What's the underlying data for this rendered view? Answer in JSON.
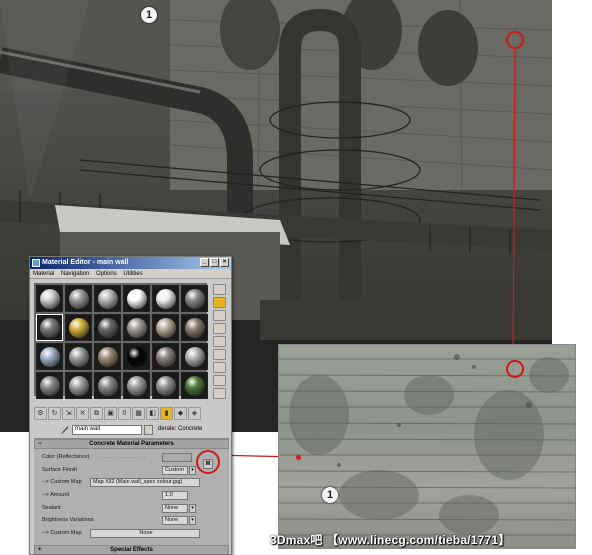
{
  "scene": {
    "marker": "1"
  },
  "texture": {
    "marker": "1"
  },
  "watermark": "3Dmax吧 【www.linecg.com/tieba/1771】",
  "editor": {
    "title": "Material Editor - main wall",
    "window_buttons": [
      "_",
      "□",
      "×"
    ],
    "menu": [
      "Material",
      "Navigation",
      "Options",
      "Utilities"
    ],
    "slots": [
      {
        "shade": "#cfcfcf"
      },
      {
        "shade": "#9a9a9a"
      },
      {
        "shade": "#b8b8b8"
      },
      {
        "shade": "#ffffff"
      },
      {
        "shade": "#f0f0f0"
      },
      {
        "shade": "#8a8a8a"
      },
      {
        "shade": "#7a7a7a"
      },
      {
        "shade": "#d2b23a"
      },
      {
        "shade": "#6a6a6a"
      },
      {
        "shade": "#a09e92"
      },
      {
        "shade": "#b5a89a"
      },
      {
        "shade": "#8a7e76"
      },
      {
        "shade": "#9fb2cc"
      },
      {
        "shade": "#a0a0a0"
      },
      {
        "shade": "#9b8b76"
      },
      {
        "shade": "#050505"
      },
      {
        "shade": "#8a8280"
      },
      {
        "shade": "#b4b4b4"
      },
      {
        "shade": "#8a8a8a"
      },
      {
        "shade": "#a2a2a2"
      },
      {
        "shade": "#8a8a8a"
      },
      {
        "shade": "#9e9e9e"
      },
      {
        "shade": "#939393"
      },
      {
        "shade": "#4f7a3a"
      }
    ],
    "selected_slot": 6,
    "material_name": "main wall",
    "material_type": "derale: Concrete",
    "rollout_title": "Concrete Material Parameters",
    "params": {
      "color_label": "Color (Reflectance)",
      "color_button": "M",
      "surface_finish_label": "Surface Finish",
      "surface_finish_value": "Custom",
      "custom_map_label": "--> Custom Map",
      "custom_map_value": "Map #32 (Main wall_spec colour.jpg)",
      "amount_label": "--> Amount",
      "amount_value": "1.0",
      "sealant_label": "Sealant",
      "sealant_value": "None",
      "brightness_label": "Brightness Variations",
      "brightness_value": "None",
      "custom_map2_label": "--> Custom Map",
      "custom_map2_value": "None"
    },
    "special_title": "Special Effects"
  }
}
